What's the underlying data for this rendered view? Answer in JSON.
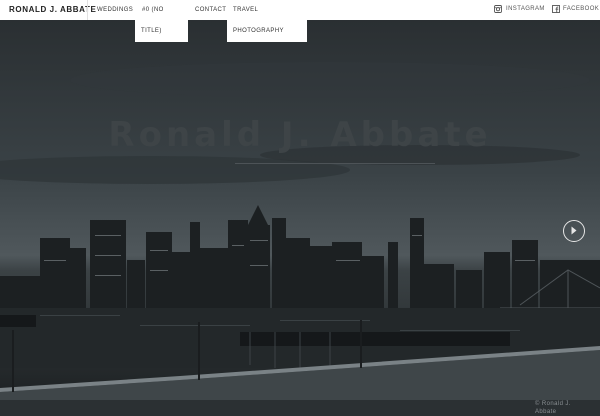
{
  "header": {
    "brand": "RONALD J. ABBATE",
    "nav": {
      "weddings": "WEDDINGS",
      "no_title_line1": "#0 (NO",
      "no_title_line2": "TITLE)",
      "contact": "CONTACT",
      "travel": "TRAVEL",
      "photography": "PHOTOGRAPHY"
    },
    "social": {
      "instagram": "INSTAGRAM",
      "facebook": "FACEBOOK"
    }
  },
  "hero": {
    "title": "Ronald J. Abbate",
    "next_icon": "chevron-right-icon"
  },
  "footer": {
    "copyright_line1": "© Ronald J.",
    "copyright_line2": "Abbate"
  },
  "colors": {
    "nav_bg": "#ffffff",
    "hero_overlay": "#2b3033",
    "text_dark": "#222222"
  }
}
